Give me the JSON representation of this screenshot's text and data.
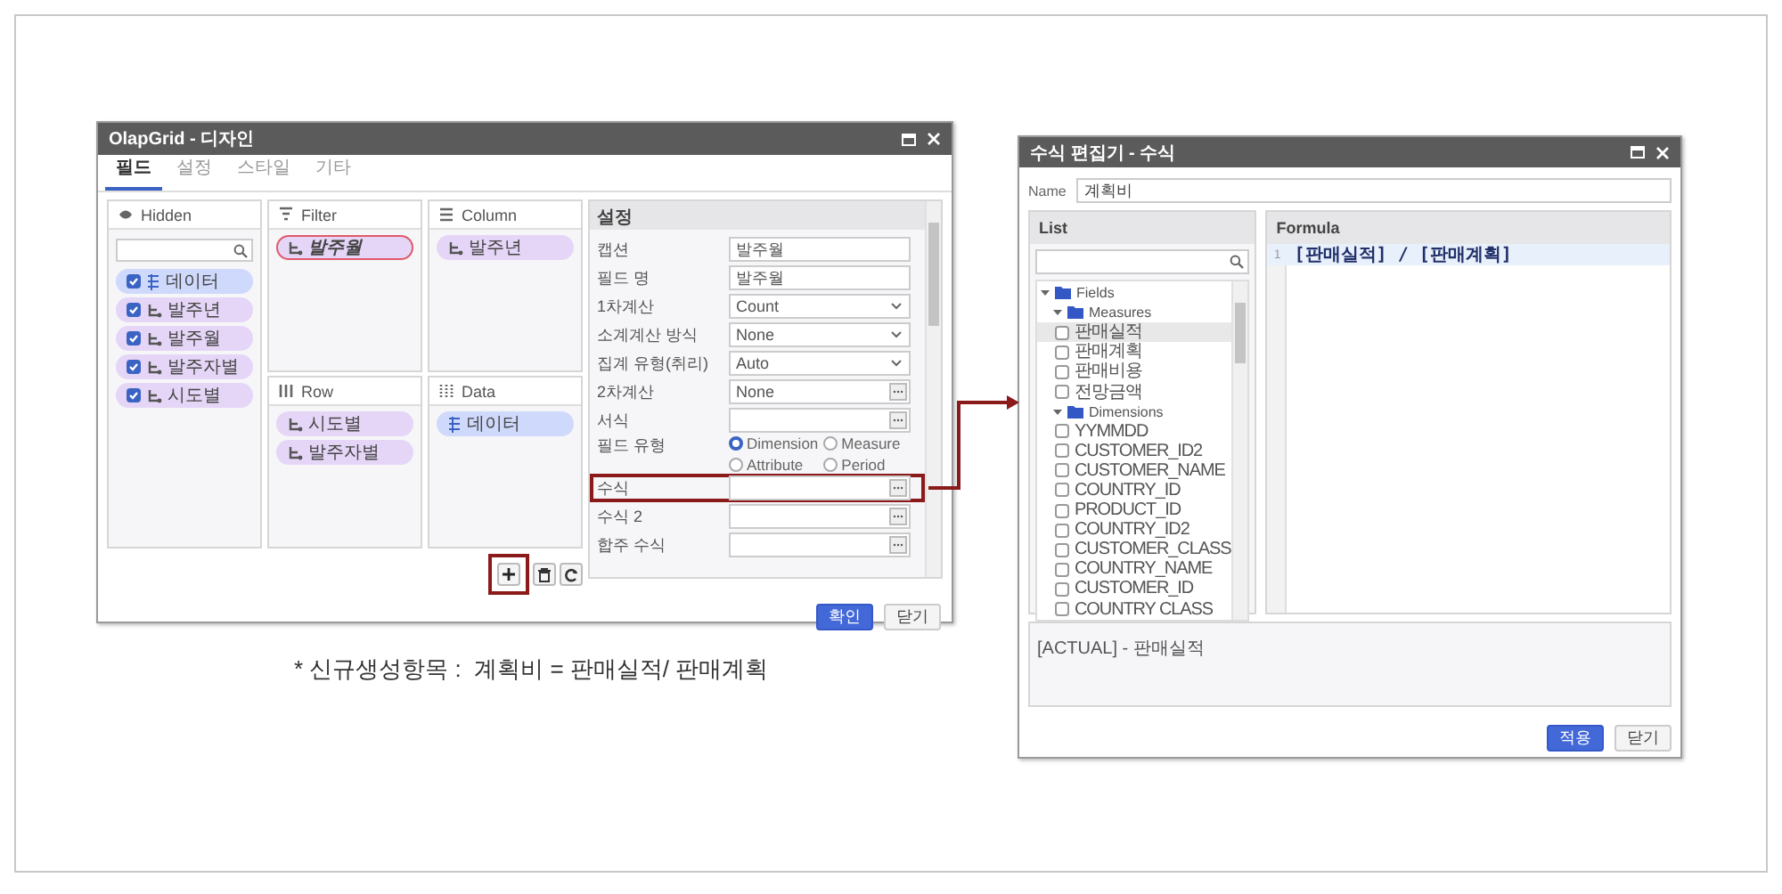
{
  "design_dialog": {
    "title": "OlapGrid - 디자인",
    "tabs": [
      {
        "label": "필드",
        "selected": true
      },
      {
        "label": "설정",
        "selected": false
      },
      {
        "label": "스타일",
        "selected": false
      },
      {
        "label": "기타",
        "selected": false
      }
    ],
    "hidden_panel": {
      "title": "Hidden",
      "items": [
        {
          "label": "데이터",
          "kind": "measure",
          "checked": true
        },
        {
          "label": "발주년",
          "kind": "dimension",
          "checked": true
        },
        {
          "label": "발주월",
          "kind": "dimension",
          "checked": true
        },
        {
          "label": "발주자별",
          "kind": "dimension",
          "checked": true
        },
        {
          "label": "시도별",
          "kind": "dimension",
          "checked": true
        }
      ]
    },
    "filter_panel": {
      "title": "Filter",
      "items": [
        {
          "label": "발주월",
          "kind": "dimension",
          "selected": true
        }
      ]
    },
    "column_panel": {
      "title": "Column",
      "items": [
        {
          "label": "발주년",
          "kind": "dimension",
          "selected": false
        }
      ]
    },
    "row_panel": {
      "title": "Row",
      "items": [
        {
          "label": "시도별",
          "kind": "dimension",
          "selected": false
        },
        {
          "label": "발주자별",
          "kind": "dimension",
          "selected": false
        }
      ]
    },
    "data_panel": {
      "title": "Data",
      "items": [
        {
          "label": "데이터",
          "kind": "measure",
          "selected": false
        }
      ]
    },
    "toolbar": [
      {
        "kind": "add",
        "highlighted": true
      },
      {
        "kind": "delete",
        "highlighted": false
      },
      {
        "kind": "refresh",
        "highlighted": false
      }
    ],
    "settings": {
      "title": "설정",
      "rows": [
        {
          "label": "캡션",
          "kind": "text",
          "value": "발주월",
          "highlighted": false
        },
        {
          "label": "필드 명",
          "kind": "text",
          "value": "발주월",
          "highlighted": false
        },
        {
          "label": "1차계산",
          "kind": "select",
          "value": "Count",
          "highlighted": false
        },
        {
          "label": "소계계산 방식",
          "kind": "select",
          "value": "None",
          "highlighted": false
        },
        {
          "label": "집계 유형(취리)",
          "kind": "select",
          "value": "Auto",
          "highlighted": false
        },
        {
          "label": "2차계산",
          "kind": "ellipsis",
          "value": "None",
          "highlighted": false
        },
        {
          "label": "서식",
          "kind": "ellipsis",
          "highlighted": false
        },
        {
          "label": "필드 유형",
          "kind": "radio",
          "highlighted": false,
          "options": [
            {
              "label": "Dimension",
              "selected": true
            },
            {
              "label": "Measure",
              "selected": false
            },
            {
              "label": "Attribute",
              "selected": false
            },
            {
              "label": "Period",
              "selected": false
            }
          ]
        },
        {
          "label": "수식",
          "kind": "ellipsis",
          "highlighted": true
        },
        {
          "label": "수식 2",
          "kind": "ellipsis",
          "highlighted": false
        },
        {
          "label": "합주 수식",
          "kind": "ellipsis",
          "highlighted": false
        }
      ]
    },
    "buttons": [
      {
        "label": "확인",
        "primary": true
      },
      {
        "label": "닫기",
        "primary": false
      }
    ]
  },
  "caption": "* 신규생성항목 :  계획비 = 판매실적/ 판매계획",
  "formula_dialog": {
    "title": "수식 편집기 - 수식",
    "name_label": "Name",
    "name_value": "계획비",
    "list": {
      "title": "List",
      "tree": [
        {
          "label": "Fields",
          "kind": "folder",
          "expanded": true,
          "children": [
            {
              "label": "Measures",
              "kind": "folder",
              "expanded": true,
              "children": [
                {
                  "label": "판매실적",
                  "kind": "field",
                  "checked": false,
                  "selected": true
                },
                {
                  "label": "판매계획",
                  "kind": "field",
                  "checked": false,
                  "selected": false
                },
                {
                  "label": "판매비용",
                  "kind": "field",
                  "checked": false,
                  "selected": false
                },
                {
                  "label": "전망금액",
                  "kind": "field",
                  "checked": false,
                  "selected": false
                }
              ]
            },
            {
              "label": "Dimensions",
              "kind": "folder",
              "expanded": true,
              "children": [
                {
                  "label": "YYMMDD",
                  "kind": "field",
                  "checked": false,
                  "selected": false
                },
                {
                  "label": "CUSTOMER_ID2",
                  "kind": "field",
                  "checked": false,
                  "selected": false
                },
                {
                  "label": "CUSTOMER_NAME",
                  "kind": "field",
                  "checked": false,
                  "selected": false
                },
                {
                  "label": "COUNTRY_ID",
                  "kind": "field",
                  "checked": false,
                  "selected": false
                },
                {
                  "label": "PRODUCT_ID",
                  "kind": "field",
                  "checked": false,
                  "selected": false
                },
                {
                  "label": "COUNTRY_ID2",
                  "kind": "field",
                  "checked": false,
                  "selected": false
                },
                {
                  "label": "CUSTOMER_CLASS",
                  "kind": "field",
                  "checked": false,
                  "selected": false
                },
                {
                  "label": "COUNTRY_NAME",
                  "kind": "field",
                  "checked": false,
                  "selected": false
                },
                {
                  "label": "CUSTOMER_ID",
                  "kind": "field",
                  "checked": false,
                  "selected": false
                },
                {
                  "label": "COUNTRY CLASS",
                  "kind": "field",
                  "checked": false,
                  "selected": false
                }
              ]
            }
          ]
        }
      ]
    },
    "formula": {
      "title": "Formula",
      "lines": [
        {
          "number": "1",
          "text": "[판매실적] / [판매계획]",
          "selected": true
        }
      ]
    },
    "description": "[ACTUAL] - 판매실적",
    "buttons": [
      {
        "label": "적용",
        "primary": true
      },
      {
        "label": "닫기",
        "primary": false
      }
    ]
  }
}
